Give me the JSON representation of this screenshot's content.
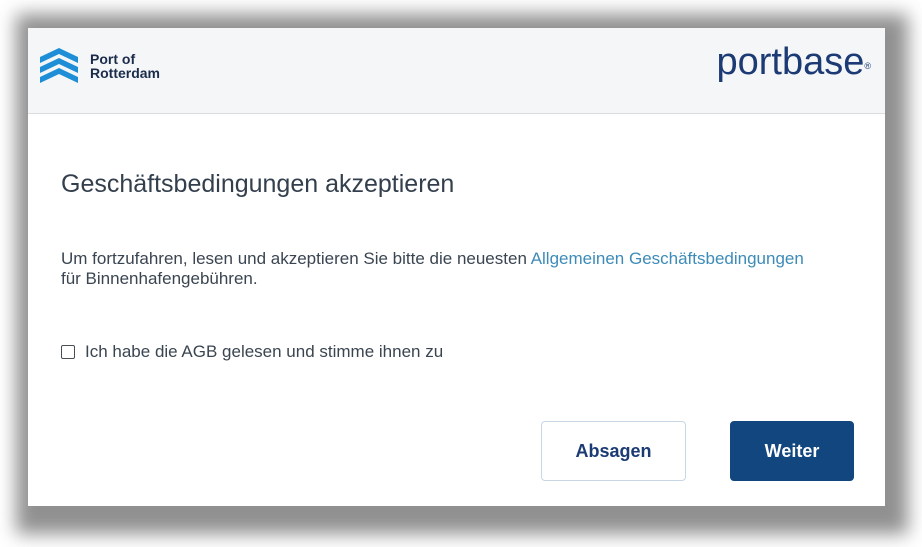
{
  "header": {
    "left_logo": {
      "name": "port-of-rotterdam-logo",
      "line1": "Port of",
      "line2": "Rotterdam"
    },
    "right_logo": {
      "name": "portbase-logo",
      "text_a": "p",
      "text_b": "o",
      "text_c": "rtbase",
      "reg": "®"
    }
  },
  "dialog": {
    "title": "Geschäftsbedingungen akzeptieren",
    "text_before": "Um fortzufahren, lesen und akzeptieren Sie bitte die neuesten ",
    "link_text": "Allgemeinen Geschäftsbedingungen",
    "text_after": " für Binnenhafengebühren.",
    "checkbox_label": "Ich habe die AGB gelesen und stimme ihnen zu",
    "checkbox_checked": false
  },
  "buttons": {
    "cancel": "Absagen",
    "next": "Weiter"
  },
  "colors": {
    "primary": "#12467f",
    "link": "#3d8bb8",
    "header_bg": "#f5f6f8",
    "logo_blue": "#1c3b74",
    "wave_blue": "#1e8fd6"
  }
}
